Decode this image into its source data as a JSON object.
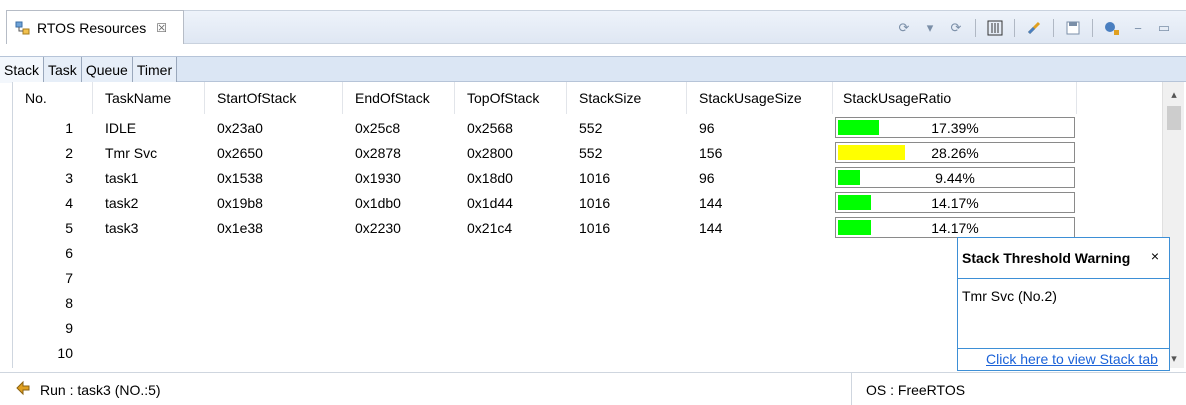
{
  "view": {
    "tab_title": "RTOS Resources",
    "tab_close": "☒",
    "toolbar_icons": [
      "refresh-settings-icon",
      "dropdown-icon",
      "refresh-icon",
      "columns-icon",
      "link-icon",
      "save-icon",
      "settings-icon",
      "minimize-icon",
      "maximize-icon"
    ]
  },
  "subtabs": [
    "Stack",
    "Task",
    "Queue",
    "Timer"
  ],
  "table": {
    "headers": [
      "No.",
      "TaskName",
      "StartOfStack",
      "EndOfStack",
      "TopOfStack",
      "StackSize",
      "StackUsageSize",
      "StackUsageRatio"
    ],
    "rows": [
      {
        "no": "1",
        "name": "IDLE",
        "start": "0x23a0",
        "end": "0x25c8",
        "top": "0x2568",
        "size": "552",
        "usage": "96",
        "ratio": "17.39%",
        "ratio_value": 0.1739,
        "bar_color": "#00ff00"
      },
      {
        "no": "2",
        "name": "Tmr Svc",
        "start": "0x2650",
        "end": "0x2878",
        "top": "0x2800",
        "size": "552",
        "usage": "156",
        "ratio": "28.26%",
        "ratio_value": 0.2826,
        "bar_color": "#ffff00"
      },
      {
        "no": "3",
        "name": "task1",
        "start": "0x1538",
        "end": "0x1930",
        "top": "0x18d0",
        "size": "1016",
        "usage": "96",
        "ratio": "9.44%",
        "ratio_value": 0.0944,
        "bar_color": "#00ff00"
      },
      {
        "no": "4",
        "name": "task2",
        "start": "0x19b8",
        "end": "0x1db0",
        "top": "0x1d44",
        "size": "1016",
        "usage": "144",
        "ratio": "14.17%",
        "ratio_value": 0.1417,
        "bar_color": "#00ff00"
      },
      {
        "no": "5",
        "name": "task3",
        "start": "0x1e38",
        "end": "0x2230",
        "top": "0x21c4",
        "size": "1016",
        "usage": "144",
        "ratio": "14.17%",
        "ratio_value": 0.1417,
        "bar_color": "#00ff00"
      },
      {
        "no": "6"
      },
      {
        "no": "7"
      },
      {
        "no": "8"
      },
      {
        "no": "9"
      },
      {
        "no": "10"
      }
    ]
  },
  "popup": {
    "title": "Stack Threshold Warning",
    "close": "×",
    "message": "Tmr Svc (No.2)",
    "link": "Click here to view Stack tab"
  },
  "status": {
    "run": "Run : task3 (NO.:5)",
    "os": "OS : FreeRTOS"
  }
}
